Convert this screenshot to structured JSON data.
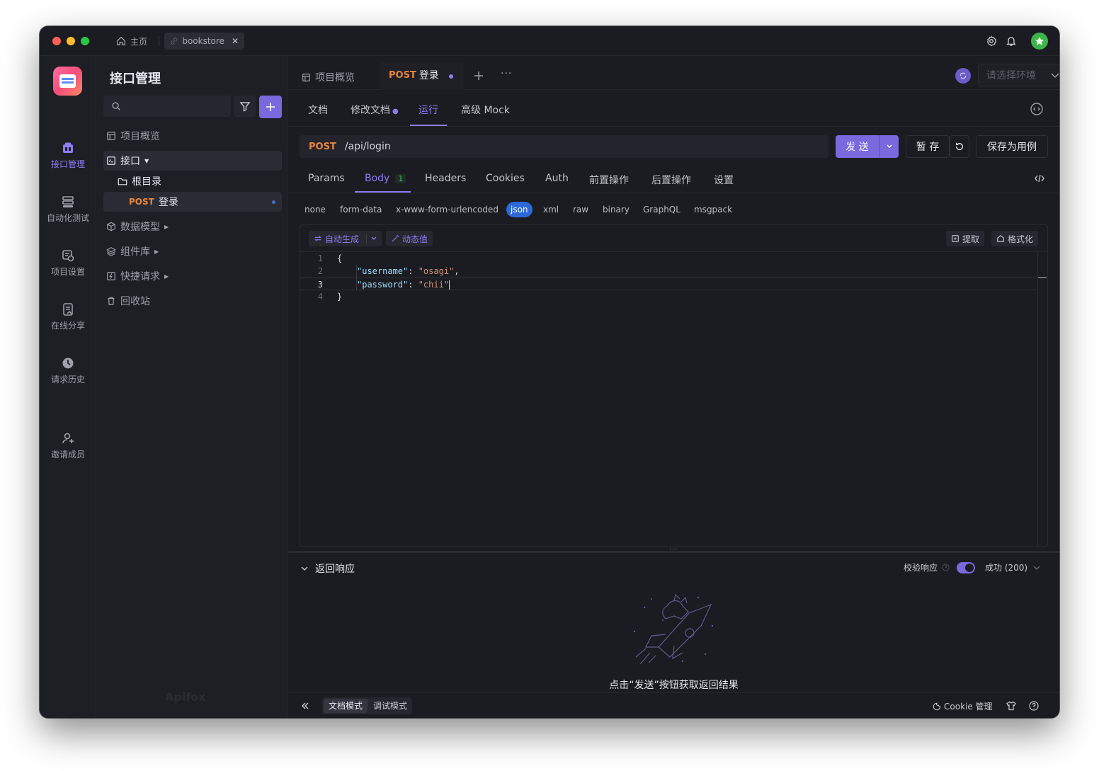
{
  "titlebar": {
    "home_tab": "主页",
    "project_tab": "bookstore"
  },
  "rail": {
    "items": [
      {
        "label": "接口管理"
      },
      {
        "label": "自动化测试"
      },
      {
        "label": "项目设置"
      },
      {
        "label": "在线分享"
      },
      {
        "label": "请求历史"
      },
      {
        "label": "邀请成员"
      }
    ]
  },
  "sidebar": {
    "title": "接口管理",
    "search_placeholder": "",
    "tree": {
      "overview": "项目概览",
      "api": "接口",
      "root": "根目录",
      "endpoint_method": "POST",
      "endpoint_name": "登录",
      "models": "数据模型",
      "components": "组件库",
      "quick": "快捷请求",
      "trash": "回收站"
    },
    "watermark": "Apifox"
  },
  "main": {
    "tabs": {
      "overview": "项目概览",
      "current_method": "POST",
      "current_name": "登录"
    },
    "env_placeholder": "请选择环境",
    "subtabs": [
      "文档",
      "修改文档",
      "运行",
      "高级 Mock"
    ],
    "url": {
      "method": "POST",
      "path": "/api/login"
    },
    "buttons": {
      "send": "发 送",
      "save_temp": "暂 存",
      "save_case": "保存为用例"
    },
    "param_tabs": [
      "Params",
      "Body",
      "Headers",
      "Cookies",
      "Auth",
      "前置操作",
      "后置操作",
      "设置"
    ],
    "body_count": "1",
    "body_types": [
      "none",
      "form-data",
      "x-www-form-urlencoded",
      "json",
      "xml",
      "raw",
      "binary",
      "GraphQL",
      "msgpack"
    ],
    "editor": {
      "auto_gen": "自动生成",
      "dynamic": "动态值",
      "extract": "提取",
      "format": "格式化",
      "lines": [
        {
          "num": "1",
          "text": "{"
        },
        {
          "num": "2",
          "key": "\"username\"",
          "value": "\"osagi\"",
          "comma": ","
        },
        {
          "num": "3",
          "key": "\"password\"",
          "value": "\"chii\"",
          "comma": ""
        },
        {
          "num": "4",
          "text": "}"
        }
      ]
    },
    "response": {
      "title": "返回响应",
      "validate": "校验响应",
      "status": "成功 (200)",
      "hint": "点击“发送”按钮获取返回结果"
    },
    "footer": {
      "doc_mode": "文档模式",
      "debug_mode": "调试模式",
      "cookie": "Cookie 管理"
    }
  },
  "colors": {
    "accent": "#8e7cf0",
    "post": "#e8853b",
    "json_chip": "#2c69d8"
  }
}
